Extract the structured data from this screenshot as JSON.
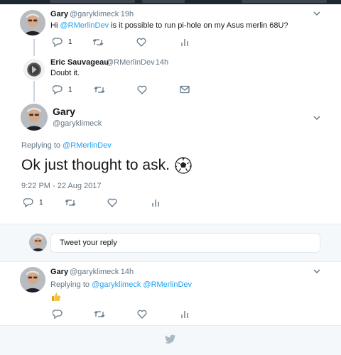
{
  "tweet1": {
    "author_name": "Gary",
    "handle": "@garyklimeck",
    "time": "· 19h",
    "text_before": "Hi",
    "mention": "@RMerlinDev",
    "text_after": "is it possible to run pi-hole on my Asus merlin 68U?",
    "reply_count": "1"
  },
  "tweet2": {
    "author_name": "Eric Sauvageau",
    "handle": "@RMerlinDev",
    "time": "· 14h",
    "text": "Doubt it.",
    "reply_count": "1"
  },
  "main_tweet": {
    "author_name": "Gary",
    "handle": "@garyklimeck",
    "replying_prefix": "Replying to",
    "replying_to": "@RMerlinDev",
    "text": "Ok just thought to ask.",
    "emoji": "soccer-ball-icon",
    "timestamp": "9:22 PM - 22 Aug 2017",
    "reply_count": "1"
  },
  "compose": {
    "placeholder": "Tweet your reply"
  },
  "tweet3": {
    "author_name": "Gary",
    "handle": "@garyklimeck",
    "time": "· 14h",
    "replying_prefix": "Replying to",
    "replying_to_1": "@garyklimeck",
    "replying_to_2": "@RMerlinDev",
    "emoji": "thumbs-up-icon"
  },
  "colors": {
    "accent": "#1da1f2",
    "muted": "#657786",
    "border": "#e6ecf0",
    "band": "#f5f8fa"
  },
  "icons": [
    "chevron-down-icon",
    "reply-icon",
    "retweet-icon",
    "like-icon",
    "analytics-icon",
    "direct-message-icon",
    "twitter-bird-icon"
  ]
}
